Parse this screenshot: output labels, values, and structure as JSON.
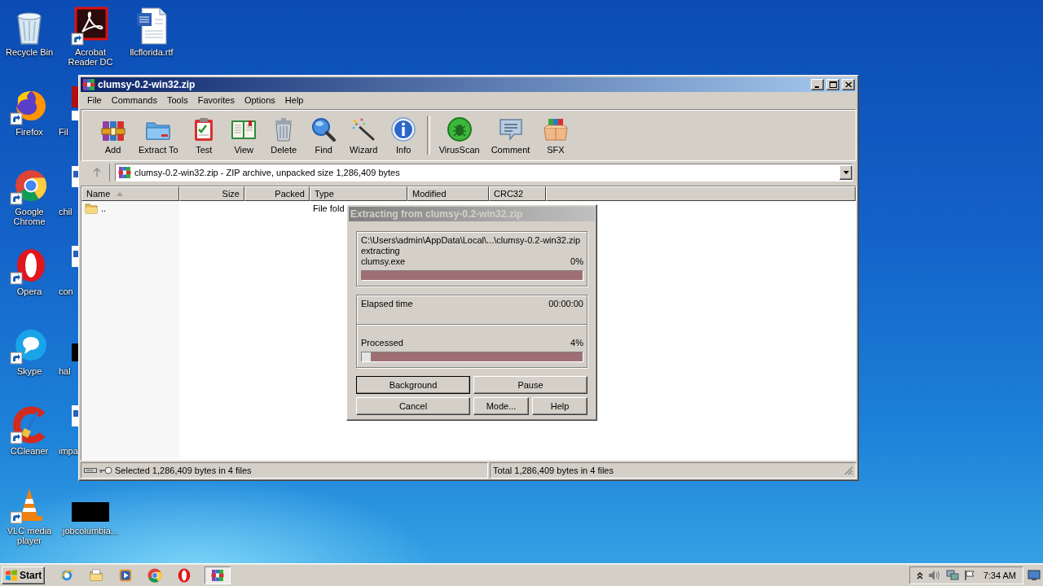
{
  "desktop_icons": [
    {
      "label": "Recycle Bin",
      "kind": "recycle-bin"
    },
    {
      "label": "Acrobat Reader DC",
      "kind": "pdf"
    },
    {
      "label": "llcflorida.rtf",
      "kind": "word-doc"
    },
    {
      "label": "Firefox",
      "kind": "firefox"
    },
    {
      "label": "Fil",
      "kind": "red-stub"
    },
    {
      "label": "Google Chrome",
      "kind": "chrome"
    },
    {
      "label": "chil",
      "kind": "doc-stub"
    },
    {
      "label": "Opera",
      "kind": "opera"
    },
    {
      "label": "con",
      "kind": "doc-stub"
    },
    {
      "label": "Skype",
      "kind": "skype"
    },
    {
      "label": "hal",
      "kind": "dark-stub"
    },
    {
      "label": "CCleaner",
      "kind": "ccleaner"
    },
    {
      "label": "impa",
      "kind": "doc-stub"
    },
    {
      "label": "VLC media player",
      "kind": "vlc"
    },
    {
      "label": "jobcolumbia...",
      "kind": "dark-thumb"
    }
  ],
  "window": {
    "title": "clumsy-0.2-win32.zip",
    "menu": [
      "File",
      "Commands",
      "Tools",
      "Favorites",
      "Options",
      "Help"
    ],
    "toolbar": [
      {
        "label": "Add",
        "kind": "add"
      },
      {
        "label": "Extract To",
        "kind": "extract"
      },
      {
        "label": "Test",
        "kind": "test"
      },
      {
        "label": "View",
        "kind": "view"
      },
      {
        "label": "Delete",
        "kind": "delete"
      },
      {
        "label": "Find",
        "kind": "find"
      },
      {
        "label": "Wizard",
        "kind": "wizard"
      },
      {
        "label": "Info",
        "kind": "info"
      },
      {
        "label": "VirusScan",
        "kind": "virusscan"
      },
      {
        "label": "Comment",
        "kind": "comment"
      },
      {
        "label": "SFX",
        "kind": "sfx"
      }
    ],
    "address": "clumsy-0.2-win32.zip - ZIP archive, unpacked size 1,286,409 bytes",
    "columns": [
      {
        "label": "Name",
        "sorted": true
      },
      {
        "label": "Size",
        "sorted": false
      },
      {
        "label": "Packed",
        "sorted": false
      },
      {
        "label": "Type",
        "sorted": false
      },
      {
        "label": "Modified",
        "sorted": false
      },
      {
        "label": "CRC32",
        "sorted": false
      }
    ],
    "rows": [
      {
        "name": "..",
        "type": "File fold"
      }
    ],
    "status_bar": {
      "selected_info": "Selected 1,286,409 bytes in 4 files",
      "total_info": "Total 1,286,409 bytes in 4 files"
    }
  },
  "dialog": {
    "title": "Extracting from clumsy-0.2-win32.zip",
    "archive_path": "C:\\Users\\admin\\AppData\\Local\\...\\clumsy-0.2-win32.zip",
    "action": "extracting",
    "file": "clumsy.exe",
    "file_percent": "0%",
    "file_progress": {
      "level": 0
    },
    "elapsed_label": "Elapsed time",
    "elapsed": "00:00:00",
    "processed_label": "Processed",
    "processed_percent": "4%",
    "processed_progress": {
      "level": 0.04
    },
    "buttons": [
      {
        "label": "Background",
        "default": true
      },
      {
        "label": "Pause",
        "default": false
      },
      {
        "label": "Cancel",
        "default": false
      },
      {
        "label": "Mode...",
        "default": false
      },
      {
        "label": "Help",
        "default": false
      }
    ]
  },
  "taskbar": {
    "start": "Start",
    "apps": [
      {
        "kind": "ie",
        "selected": false
      },
      {
        "kind": "explorer",
        "selected": false
      },
      {
        "kind": "media",
        "selected": false
      },
      {
        "kind": "chrome",
        "selected": false
      },
      {
        "kind": "opera",
        "selected": false
      },
      {
        "kind": "winrar",
        "selected": true
      }
    ],
    "clock": "7:34 AM"
  }
}
